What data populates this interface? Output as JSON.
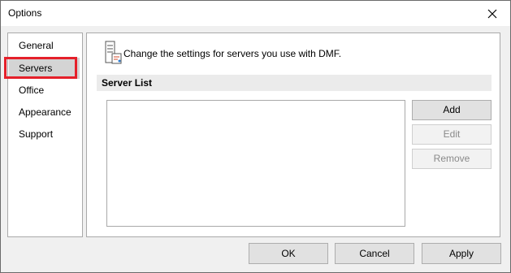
{
  "window": {
    "title": "Options"
  },
  "nav": {
    "items": [
      {
        "label": "General"
      },
      {
        "label": "Servers",
        "selected": true
      },
      {
        "label": "Office"
      },
      {
        "label": "Appearance"
      },
      {
        "label": "Support"
      }
    ]
  },
  "content": {
    "description": "Change the settings for servers you use with DMF.",
    "section_title": "Server List",
    "buttons": {
      "add": "Add",
      "edit": "Edit",
      "remove": "Remove"
    }
  },
  "footer": {
    "ok": "OK",
    "cancel": "Cancel",
    "apply": "Apply"
  },
  "colors": {
    "highlight": "#e5202a",
    "selected_bg": "#d4d4d4",
    "section_bg": "#ebebeb"
  },
  "icons": {
    "close": "close-icon",
    "server": "server-settings-icon"
  }
}
